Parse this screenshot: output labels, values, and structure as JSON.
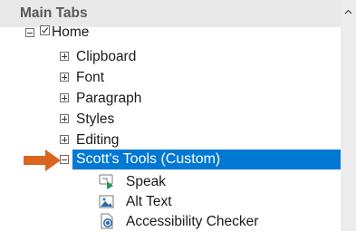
{
  "panel": {
    "title": "Main Tabs"
  },
  "tree": {
    "home": {
      "label": "Home",
      "checked": true
    },
    "groups": [
      {
        "label": "Clipboard"
      },
      {
        "label": "Font"
      },
      {
        "label": "Paragraph"
      },
      {
        "label": "Styles"
      },
      {
        "label": "Editing"
      }
    ],
    "custom_group": {
      "label": "Scott's Tools (Custom)",
      "selected": true,
      "commands": [
        {
          "label": "Speak",
          "icon": "speak-icon"
        },
        {
          "label": "Alt Text",
          "icon": "image-alt-text-icon"
        },
        {
          "label": "Accessibility Checker",
          "icon": "accessibility-checker-icon"
        }
      ]
    }
  },
  "colors": {
    "selection": "#0078d4",
    "arrow": "#d9651e",
    "header_bg": "#e9e9e9"
  }
}
